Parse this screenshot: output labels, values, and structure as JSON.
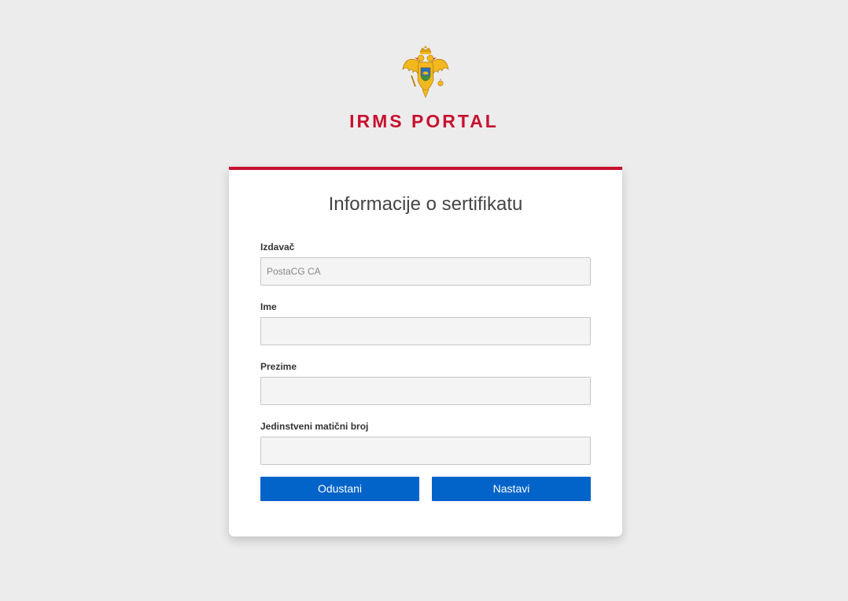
{
  "header": {
    "emblem_icon": "montenegro-coat-of-arms-icon",
    "title": "IRMS PORTAL",
    "accent_color": "#c8102e"
  },
  "form": {
    "title": "Informacije o sertifikatu",
    "fields": [
      {
        "label": "Izdavač",
        "value": "PostaCG CA"
      },
      {
        "label": "Ime",
        "value": ""
      },
      {
        "label": "Prezime",
        "value": ""
      },
      {
        "label": "Jedinstveni matični broj",
        "value": ""
      }
    ],
    "buttons": {
      "cancel_label": "Odustani",
      "continue_label": "Nastavi",
      "color": "#0263c9"
    }
  }
}
